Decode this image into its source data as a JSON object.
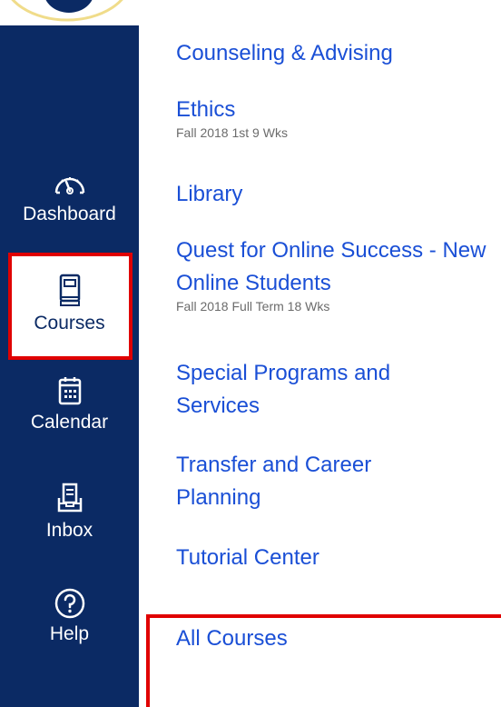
{
  "nav": {
    "items": [
      {
        "key": "dashboard",
        "label": "Dashboard",
        "icon": "dashboard-gauge-icon"
      },
      {
        "key": "courses",
        "label": "Courses",
        "icon": "book-icon"
      },
      {
        "key": "calendar",
        "label": "Calendar",
        "icon": "calendar-icon"
      },
      {
        "key": "inbox",
        "label": "Inbox",
        "icon": "inbox-icon"
      },
      {
        "key": "help",
        "label": "Help",
        "icon": "help-question-icon"
      }
    ],
    "colors": {
      "background": "#0b2a64",
      "text": "#ffffff",
      "highlight": "#e00000"
    }
  },
  "courses": {
    "items": [
      {
        "title": "Counseling & Advising",
        "term": ""
      },
      {
        "title": "Ethics",
        "term": "Fall 2018 1st 9 Wks"
      },
      {
        "title": "Library",
        "term": ""
      },
      {
        "title": "Quest for Online Success - New Online Students",
        "term": "Fall 2018 Full Term 18 Wks"
      },
      {
        "title": "Special Programs and Services",
        "term": ""
      },
      {
        "title": "Transfer and Career Planning",
        "term": ""
      },
      {
        "title": "Tutorial Center",
        "term": ""
      }
    ],
    "all_courses_label": "All Courses",
    "link_color": "#1a4fd6"
  }
}
